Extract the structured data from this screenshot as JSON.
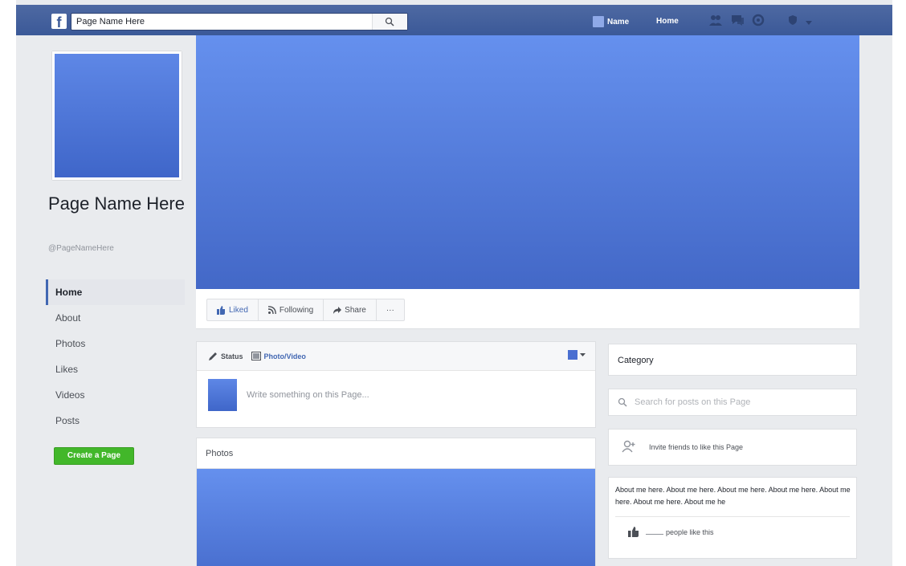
{
  "topbar": {
    "logo": "f",
    "search_value": "Page Name Here",
    "profile_name": "Name",
    "home_label": "Home",
    "icons": [
      "friend-requests-icon",
      "messages-icon",
      "notifications-icon",
      "privacy-icon",
      "settings-caret-icon"
    ]
  },
  "left": {
    "page_name": "Page Name Here",
    "page_handle": "@PageNameHere",
    "nav": [
      "Home",
      "About",
      "Photos",
      "Likes",
      "Videos",
      "Posts"
    ],
    "create_page_label": "Create a Page"
  },
  "actions": {
    "liked": "Liked",
    "following": "Following",
    "share": "Share",
    "more": "···"
  },
  "composer": {
    "status_tab": "Status",
    "photo_tab": "Photo/Video",
    "placeholder": "Write something on this Page..."
  },
  "photos": {
    "title": "Photos"
  },
  "sidebar": {
    "category": "Category",
    "search_placeholder": "Search for posts on this Page",
    "invite_text": "Invite friends to like this Page",
    "about_text": "About me here. About me here. About me here. About me here. About me here. About me here. About me he",
    "likes_text": "people like this"
  },
  "colors": {
    "brand": "#3b5998",
    "cover_top": "#6590ee",
    "cover_bottom": "#4368c7",
    "create_button": "#42b72a"
  }
}
